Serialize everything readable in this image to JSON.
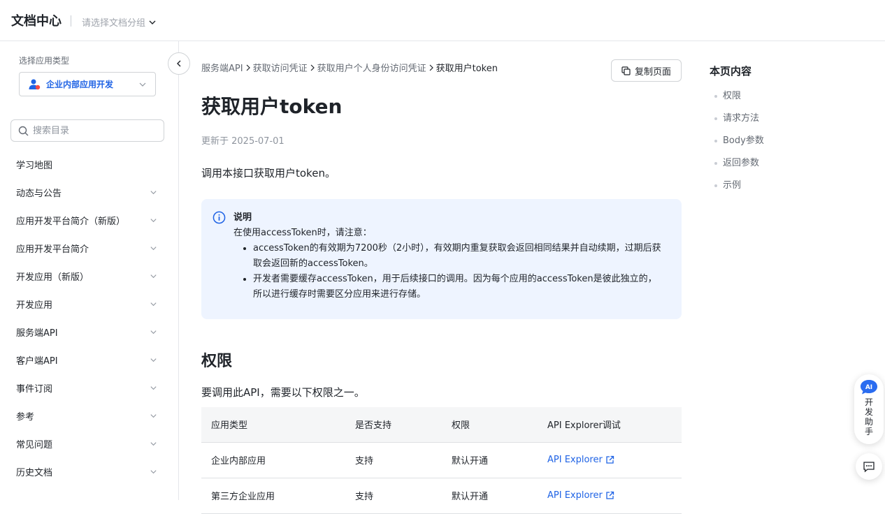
{
  "header": {
    "site_title": "文档中心",
    "group_placeholder": "请选择文档分组"
  },
  "sidebar": {
    "app_type_label": "选择应用类型",
    "app_type_value": "企业内部应用开发",
    "search_placeholder": "搜索目录",
    "items": [
      {
        "label": "学习地图",
        "expandable": false
      },
      {
        "label": "动态与公告",
        "expandable": true
      },
      {
        "label": "应用开发平台简介（新版）",
        "expandable": true
      },
      {
        "label": "应用开发平台简介",
        "expandable": true
      },
      {
        "label": "开发应用（新版）",
        "expandable": true
      },
      {
        "label": "开发应用",
        "expandable": true
      },
      {
        "label": "服务端API",
        "expandable": true
      },
      {
        "label": "客户端API",
        "expandable": true
      },
      {
        "label": "事件订阅",
        "expandable": true
      },
      {
        "label": "参考",
        "expandable": true
      },
      {
        "label": "常见问题",
        "expandable": true
      },
      {
        "label": "历史文档",
        "expandable": true
      }
    ]
  },
  "main": {
    "breadcrumb": [
      "服务端API",
      "获取访问凭证",
      "获取用户个人身份访问凭证",
      "获取用户token"
    ],
    "copy_button": "复制页面",
    "title": "获取用户token",
    "updated": "更新于 2025-07-01",
    "intro": "调用本接口获取用户token。",
    "note": {
      "title": "说明",
      "text": "在使用accessToken时，请注意：",
      "bullets": [
        "accessToken的有效期为7200秒（2小时），有效期内重复获取会返回相同结果并自动续期，过期后获取会返回新的accessToken。",
        "开发者需要缓存accessToken，用于后续接口的调用。因为每个应用的accessToken是彼此独立的，所以进行缓存时需要区分应用来进行存储。"
      ]
    },
    "permission": {
      "title": "权限",
      "desc": "要调用此API，需要以下权限之一。",
      "columns": [
        "应用类型",
        "是否支持",
        "权限",
        "API Explorer调试"
      ],
      "rows": [
        [
          "企业内部应用",
          "支持",
          "默认开通",
          "API Explorer"
        ],
        [
          "第三方企业应用",
          "支持",
          "默认开通",
          "API Explorer"
        ]
      ]
    }
  },
  "toc": {
    "title": "本页内容",
    "items": [
      "权限",
      "请求方法",
      "Body参数",
      "返回参数",
      "示例"
    ]
  },
  "assistant": {
    "label": "开发助手"
  },
  "colors": {
    "accent": "#1f63e5",
    "note_bg": "#eef4ff",
    "table_header_bg": "#f5f6f7"
  }
}
